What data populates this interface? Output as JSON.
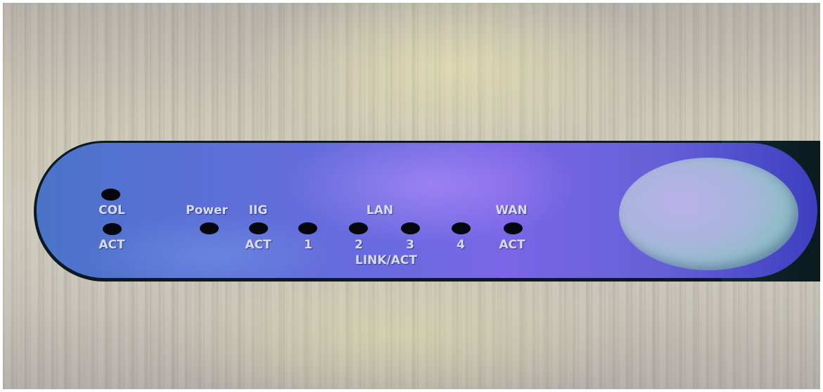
{
  "labels": {
    "col": "COL",
    "act_left": "ACT",
    "power": "Power",
    "iig": "IIG",
    "iig_act": "ACT",
    "lan": "LAN",
    "port_1": "1",
    "port_2": "2",
    "port_3": "3",
    "port_4": "4",
    "link_act": "LINK/ACT",
    "wan": "WAN",
    "wan_act": "ACT"
  },
  "colors": {
    "faceplate": "#6a6ae0",
    "led_off": "#05070c",
    "label_text": "#d8dcf0"
  }
}
